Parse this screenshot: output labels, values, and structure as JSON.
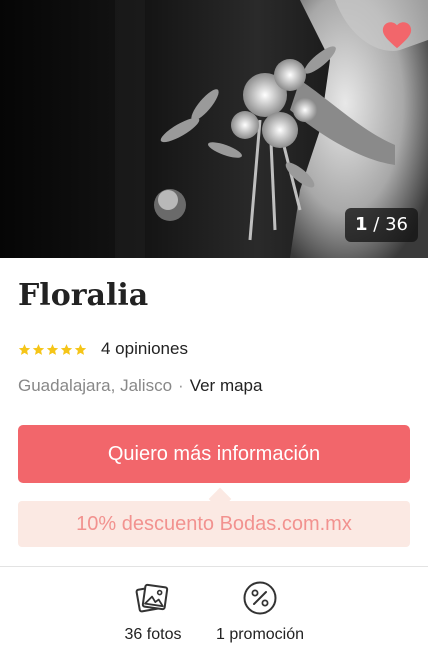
{
  "gallery": {
    "counter_current": "1",
    "counter_separator": " / ",
    "counter_total": "36",
    "favorite_color": "#f2666b"
  },
  "vendor": {
    "name": "Floralia",
    "rating_stars": 5,
    "reviews": "4 opiniones",
    "location": "Guadalajara, Jalisco",
    "location_separator": "·",
    "map_link": "Ver mapa"
  },
  "cta": {
    "label": "Quiero más información",
    "color": "#f2666b"
  },
  "promo": {
    "label": "10% descuento Bodas.com.mx"
  },
  "actions": [
    {
      "label": "36 fotos",
      "icon": "photos-icon"
    },
    {
      "label": "1 promoción",
      "icon": "percent-icon"
    }
  ]
}
